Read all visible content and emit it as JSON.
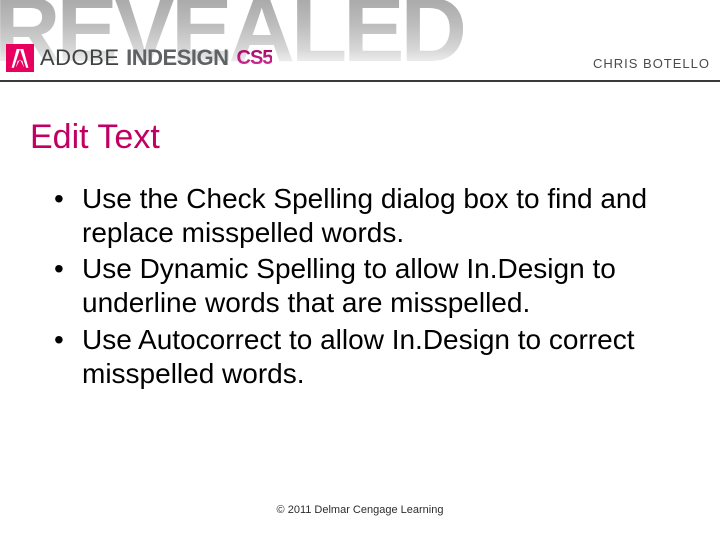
{
  "banner": {
    "background_word": "REVEALED",
    "brand_prefix": "ADOBE",
    "brand_product": "INDESIGN",
    "brand_suffix": "CS5",
    "author": "CHRIS BOTELLO"
  },
  "title": "Edit Text",
  "bullets": [
    "Use the Check Spelling dialog box to find and replace misspelled words.",
    "Use Dynamic Spelling to allow In.Design to underline words that are misspelled.",
    "Use Autocorrect to allow In.Design to correct misspelled words."
  ],
  "footer": "© 2011 Delmar Cengage Learning"
}
